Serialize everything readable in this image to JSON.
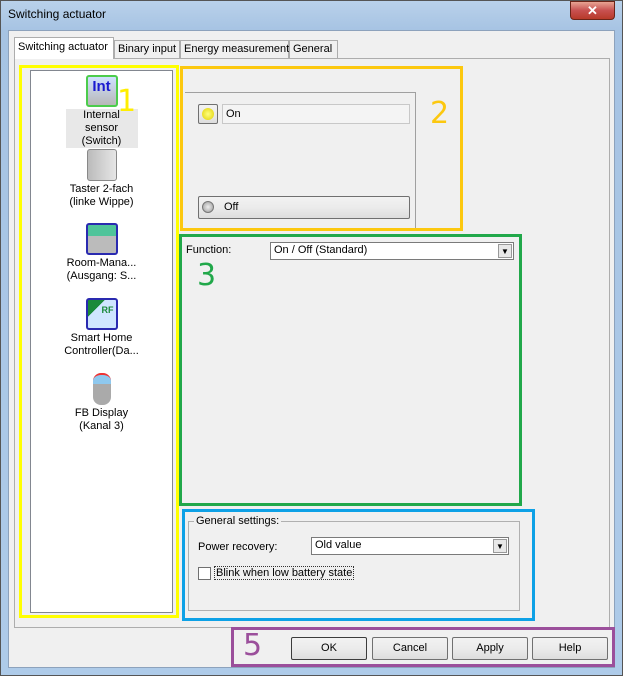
{
  "window": {
    "title": "Switching actuator",
    "close_icon": "close-icon"
  },
  "tabs": [
    {
      "label": "Switching actuator",
      "active": true
    },
    {
      "label": "Binary input"
    },
    {
      "label": "Energy measurement"
    },
    {
      "label": "General"
    }
  ],
  "devices": [
    {
      "line1": "Internal sensor",
      "line2": "(Switch)",
      "icon": "int-sensor-icon",
      "selected": true
    },
    {
      "line1": "Taster 2-fach",
      "line2": "(linke Wippe)",
      "icon": "rocker-switch-icon"
    },
    {
      "line1": "Room-Mana...",
      "line2": "(Ausgang: S...",
      "icon": "room-manager-icon"
    },
    {
      "line1": "Smart Home",
      "line2": "Controller(Da...",
      "icon": "smart-home-controller-icon"
    },
    {
      "line1": "FB Display",
      "line2": "(Kanal 3)",
      "icon": "remote-control-icon"
    }
  ],
  "state": {
    "on_label": "On",
    "off_label": "Off"
  },
  "function": {
    "label": "Function:",
    "value": "On / Off (Standard)"
  },
  "general": {
    "title": "General settings:",
    "power_recovery_label": "Power recovery:",
    "power_recovery_value": "Old value",
    "blink_label": "Blink when low battery state",
    "blink_checked": false
  },
  "buttons": {
    "ok": "OK",
    "cancel": "Cancel",
    "apply": "Apply",
    "help": "Help"
  },
  "annotations": {
    "n1": "1",
    "n2": "2",
    "n3": "3",
    "n5": "5"
  },
  "colors": {
    "area1": "#ffff00",
    "area2": "#fcc80f",
    "area3": "#21a84a",
    "area4": "#0ea1e6",
    "area5": "#9b4f9b"
  }
}
